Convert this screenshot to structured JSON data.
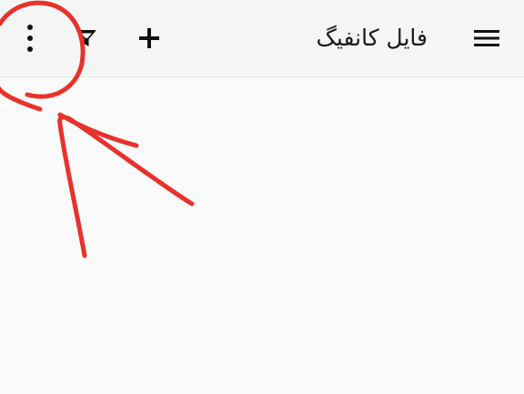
{
  "toolbar": {
    "title": "فایل کانفیگ",
    "icons": {
      "more": "more-vertical-icon",
      "filter": "filter-icon",
      "add": "plus-icon",
      "menu": "hamburger-menu-icon"
    }
  },
  "colors": {
    "toolbar_bg": "#f5f5f5",
    "content_bg": "#fafafa",
    "icon": "#111111",
    "annotation": "#e8322b"
  }
}
